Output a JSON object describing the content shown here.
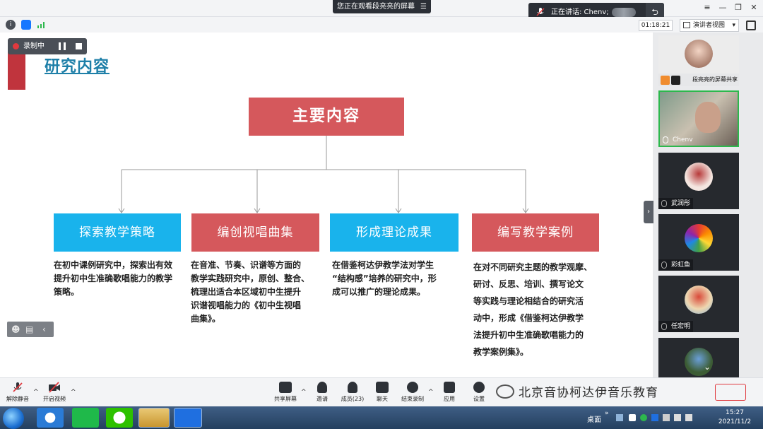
{
  "top": {
    "viewing_label": "您正在观看段亮亮的屏幕",
    "viewing_menu": "☰",
    "speaking_label": "正在讲话: Chenv;"
  },
  "window_controls": {
    "menu": "≡",
    "minimize": "—",
    "restore": "❐",
    "close": "✕"
  },
  "status": {
    "timer": "01:18:21",
    "presenter_view": "演讲者视图",
    "presenter_caret": "▾"
  },
  "recording": {
    "label": "录制中"
  },
  "slide": {
    "title": "研究内容",
    "main": "主要内容",
    "categories": [
      {
        "label": "探索教学策略",
        "color": "#19b3ec",
        "desc": [
          "在初中课例研究中，探索出有效",
          "提升初中生准确歌唱能力的教学",
          "策略。"
        ]
      },
      {
        "label": "编创视唱曲集",
        "color": "#d5585c",
        "desc": [
          "在音准、节奏、识谱等方面的",
          "教学实践研究中，原创、整合、",
          "梳理出适合本区域初中生提升",
          "识谱视唱能力的《初中生视唱",
          "曲集》。"
        ]
      },
      {
        "label": "形成理论成果",
        "color": "#19b3ec",
        "desc": [
          "在借鉴柯达伊教学法对学生",
          "“结构感”培养的研究中，形",
          "成可以推广的理论成果。"
        ]
      },
      {
        "label": "编写教学案例",
        "color": "#d5585c",
        "desc": [
          "在对不同研究主题的教学观摩、",
          "研讨、反思、培训、撰写论文",
          "等实践与理论相结合的研究活",
          "动中，形成《借鉴柯达伊教学",
          "法提升初中生准确歌唱能力的",
          "教学案例集》。"
        ]
      }
    ]
  },
  "participants": [
    {
      "name": "段亮亮的屏幕共享"
    },
    {
      "name": "Chenv"
    },
    {
      "name": "武润彤"
    },
    {
      "name": "彩虹鱼"
    },
    {
      "name": "任宏明"
    }
  ],
  "toolbar": {
    "mute": "解除静音",
    "video": "开启视频",
    "share": "共享屏幕",
    "invite": "邀请",
    "members": "成员(23)",
    "chat": "聊天",
    "end_record": "结束录制",
    "apps": "应用",
    "settings": "设置"
  },
  "watermark": "北京音协柯达伊音乐教育",
  "taskbar": {
    "desktop": "桌面",
    "time": "15:27",
    "date": "2021/11/2"
  },
  "colors": {
    "accent_red": "#d5585c",
    "accent_blue": "#19b3ec",
    "title_blue": "#1e7fa8"
  }
}
